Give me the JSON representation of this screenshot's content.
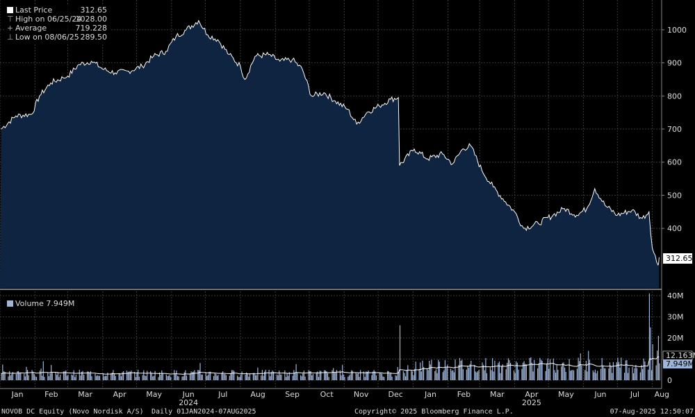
{
  "footer": {
    "security": "NOVOB DC Equity (Novo Nordisk A/S)",
    "period": "Daily 01JAN2024-07AUG2025",
    "copyright": "Copyright© 2025 Bloomberg Finance L.P.",
    "timestamp": "07-Aug-2025 12:50:07"
  },
  "legend": {
    "last_label": "Last Price",
    "last_value": "312.65",
    "high_label": "High on 06/25/24",
    "high_value": "1028.00",
    "avg_label": "Average",
    "avg_value": "719.228",
    "low_label": "Low on 08/06/25",
    "low_value": "289.50"
  },
  "volume_legend": {
    "label": "Volume",
    "value": "7.949M"
  },
  "colors": {
    "background": "#000000",
    "area_fill": "#0e2440",
    "price_line": "#ffffff",
    "volume_bar": "#9fb6d9",
    "grid": "#3a3a3a"
  },
  "chart_data": [
    {
      "type": "area",
      "name": "Last Price",
      "ylim": [
        220,
        1090
      ],
      "yticks": [
        "400",
        "500",
        "600",
        "700",
        "800",
        "900",
        "1000"
      ],
      "last_value_label": "312.65",
      "x_months": [
        "Jan",
        "Feb",
        "Mar",
        "Apr",
        "May",
        "Jun",
        "Jul",
        "Aug",
        "Sep",
        "Oct",
        "Nov",
        "Dec",
        "Jan",
        "Feb",
        "Mar",
        "Apr",
        "May",
        "Jun",
        "Jul",
        "Aug"
      ],
      "year_labels": [
        {
          "month_index": 5,
          "label": "2024"
        },
        {
          "month_index": 15,
          "label": "2025"
        }
      ],
      "x": [
        "2024-01-02",
        "2024-01-15",
        "2024-01-29",
        "2024-02-05",
        "2024-02-15",
        "2024-02-26",
        "2024-03-01",
        "2024-03-11",
        "2024-03-22",
        "2024-04-02",
        "2024-04-12",
        "2024-04-24",
        "2024-05-06",
        "2024-05-16",
        "2024-05-27",
        "2024-06-05",
        "2024-06-14",
        "2024-06-25",
        "2024-07-03",
        "2024-07-12",
        "2024-07-22",
        "2024-08-01",
        "2024-08-05",
        "2024-08-14",
        "2024-08-26",
        "2024-09-05",
        "2024-09-16",
        "2024-09-25",
        "2024-10-03",
        "2024-10-14",
        "2024-10-24",
        "2024-11-04",
        "2024-11-12",
        "2024-11-21",
        "2024-12-02",
        "2024-12-12",
        "2024-12-19",
        "2024-12-20",
        "2025-01-02",
        "2025-01-14",
        "2025-01-27",
        "2025-02-05",
        "2025-02-14",
        "2025-02-21",
        "2025-03-03",
        "2025-03-13",
        "2025-03-24",
        "2025-04-01",
        "2025-04-09",
        "2025-04-22",
        "2025-05-05",
        "2025-05-15",
        "2025-05-26",
        "2025-06-04",
        "2025-06-11",
        "2025-06-20",
        "2025-07-01",
        "2025-07-14",
        "2025-07-23",
        "2025-07-29",
        "2025-08-01",
        "2025-08-06",
        "2025-08-07"
      ],
      "y": [
        700,
        740,
        745,
        800,
        840,
        855,
        860,
        895,
        905,
        880,
        870,
        875,
        890,
        920,
        935,
        980,
        1000,
        1028,
        985,
        970,
        925,
        890,
        850,
        920,
        925,
        905,
        910,
        880,
        800,
        810,
        785,
        760,
        715,
        750,
        770,
        790,
        795,
        590,
        640,
        610,
        625,
        595,
        640,
        650,
        575,
        525,
        480,
        450,
        400,
        415,
        440,
        460,
        440,
        460,
        520,
        470,
        440,
        455,
        430,
        450,
        340,
        289.5,
        312.65
      ]
    },
    {
      "type": "bar",
      "name": "Volume",
      "ylim": [
        0,
        42
      ],
      "yticks": [
        "0",
        "10M",
        "20M",
        "30M",
        "40M"
      ],
      "value_labels": [
        "12.163M",
        "7.949M"
      ]
    }
  ]
}
